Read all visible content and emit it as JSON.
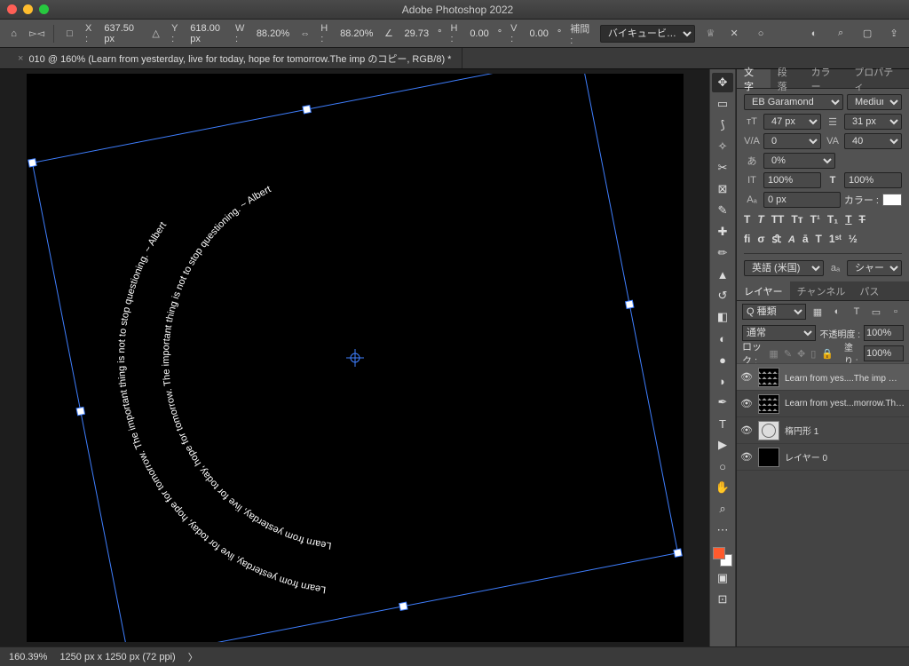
{
  "titlebar": {
    "app": "Adobe Photoshop 2022"
  },
  "optionsbar": {
    "x_lbl": "X :",
    "x": "637.50 px",
    "y_lbl": "Y :",
    "y": "618.00 px",
    "w_lbl": "W :",
    "w": "88.20%",
    "h_lbl": "H :",
    "h": "88.20%",
    "angle": "29.73",
    "angle_deg": "°",
    "hskew_lbl": "H :",
    "hskew": "0.00",
    "vskew_lbl": "V :",
    "vskew": "0.00",
    "interp_lbl": "補間 :",
    "interp": "バイキュービ…"
  },
  "doctab": {
    "title": "010 @ 160% (Learn from yesterday, live for today, hope for tomorrow.The imp のコピー, RGB/8) *"
  },
  "art": {
    "outer": "Learn from yesterday, live for today, hope for tomorrow. The important thing is not to stop questioning. ~ Albert",
    "inner": "Learn from yesterday, live for today, hope for tomorrow. The important thing is not to stop questioning. ~ Albert"
  },
  "status": {
    "zoom": "160.39%",
    "docsize": "1250 px x 1250 px (72 ppi)"
  },
  "char": {
    "tab_char": "文字",
    "tab_para": "段落",
    "tab_color": "カラー",
    "tab_prop": "プロパティ",
    "font": "EB Garamond",
    "style": "Medium",
    "size": "47 px",
    "leading": "31 px",
    "va": "0",
    "tracking": "40",
    "tsume": "0%",
    "vscale": "100%",
    "hscale": "100%",
    "baseline": "0 px",
    "color_lbl": "カラー :",
    "lang": "英語 (米国)",
    "aa": "シャープ"
  },
  "layerspanel": {
    "tab_layers": "レイヤー",
    "tab_channels": "チャンネル",
    "tab_paths": "パス",
    "filter": "Q 種類",
    "blend": "通常",
    "opac_lbl": "不透明度 :",
    "opac": "100%",
    "fill_lbl": "塗り :",
    "fill": "100%",
    "lock_lbl": "ロック :",
    "layers": [
      {
        "name": "Learn from yes....The imp のコピー",
        "sel": true,
        "thumb": "trans"
      },
      {
        "name": "Learn from yest...morrow.The imp",
        "thumb": "trans"
      },
      {
        "name": "楕円形 1",
        "thumb": "ellipse"
      },
      {
        "name": "レイヤー 0",
        "thumb": "solid"
      }
    ]
  }
}
